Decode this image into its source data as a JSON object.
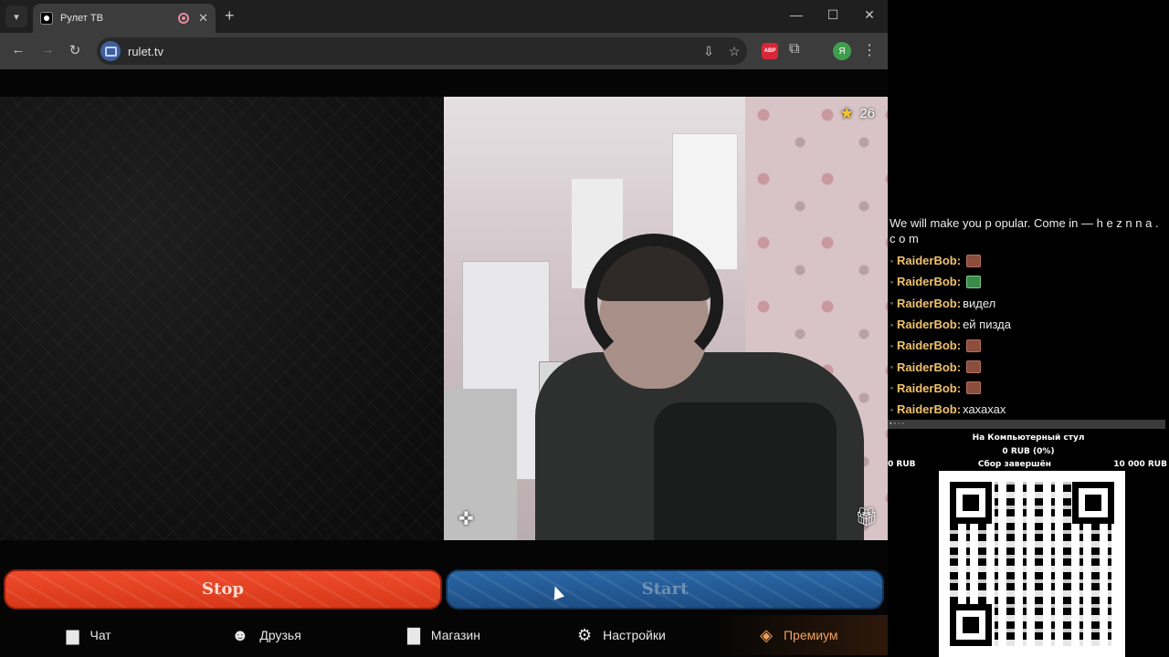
{
  "browser": {
    "tab_title": "Рулет ТВ",
    "url": "rulet.tv",
    "profile_initial": "Я",
    "abp_label": "ABP"
  },
  "video": {
    "score": "26"
  },
  "buttons": {
    "stop": "Stop",
    "start": "Start"
  },
  "nav": {
    "chat": "Чат",
    "friends": "Друзья",
    "shop": "Магазин",
    "settings": "Настройки",
    "premium": "Премиум"
  },
  "chat": {
    "promo": "We will make you p opular. Come in — h e z n n a . c o m",
    "messages": [
      {
        "user": "RaiderBob:",
        "text": "",
        "emote": "brown"
      },
      {
        "user": "RaiderBob:",
        "text": "",
        "emote": "green"
      },
      {
        "user": "RaiderBob:",
        "text": "видел",
        "emote": ""
      },
      {
        "user": "RaiderBob:",
        "text": "ей пизда",
        "emote": ""
      },
      {
        "user": "RaiderBob:",
        "text": "",
        "emote": "brown"
      },
      {
        "user": "RaiderBob:",
        "text": "",
        "emote": "brown"
      },
      {
        "user": "RaiderBob:",
        "text": "",
        "emote": "brown"
      },
      {
        "user": "RaiderBob:",
        "text": "хахахах",
        "emote": ""
      }
    ]
  },
  "goal": {
    "title": "На Компьютерный стул",
    "amount": "0 RUB (0%)",
    "min": "0 RUB",
    "status": "Сбор завершён",
    "max": "10 000 RUB"
  },
  "colors": {
    "stop_button": "#e2421f",
    "start_button": "#245a95",
    "premium": "#f0a15a",
    "chat_username": "#f0c26a"
  }
}
